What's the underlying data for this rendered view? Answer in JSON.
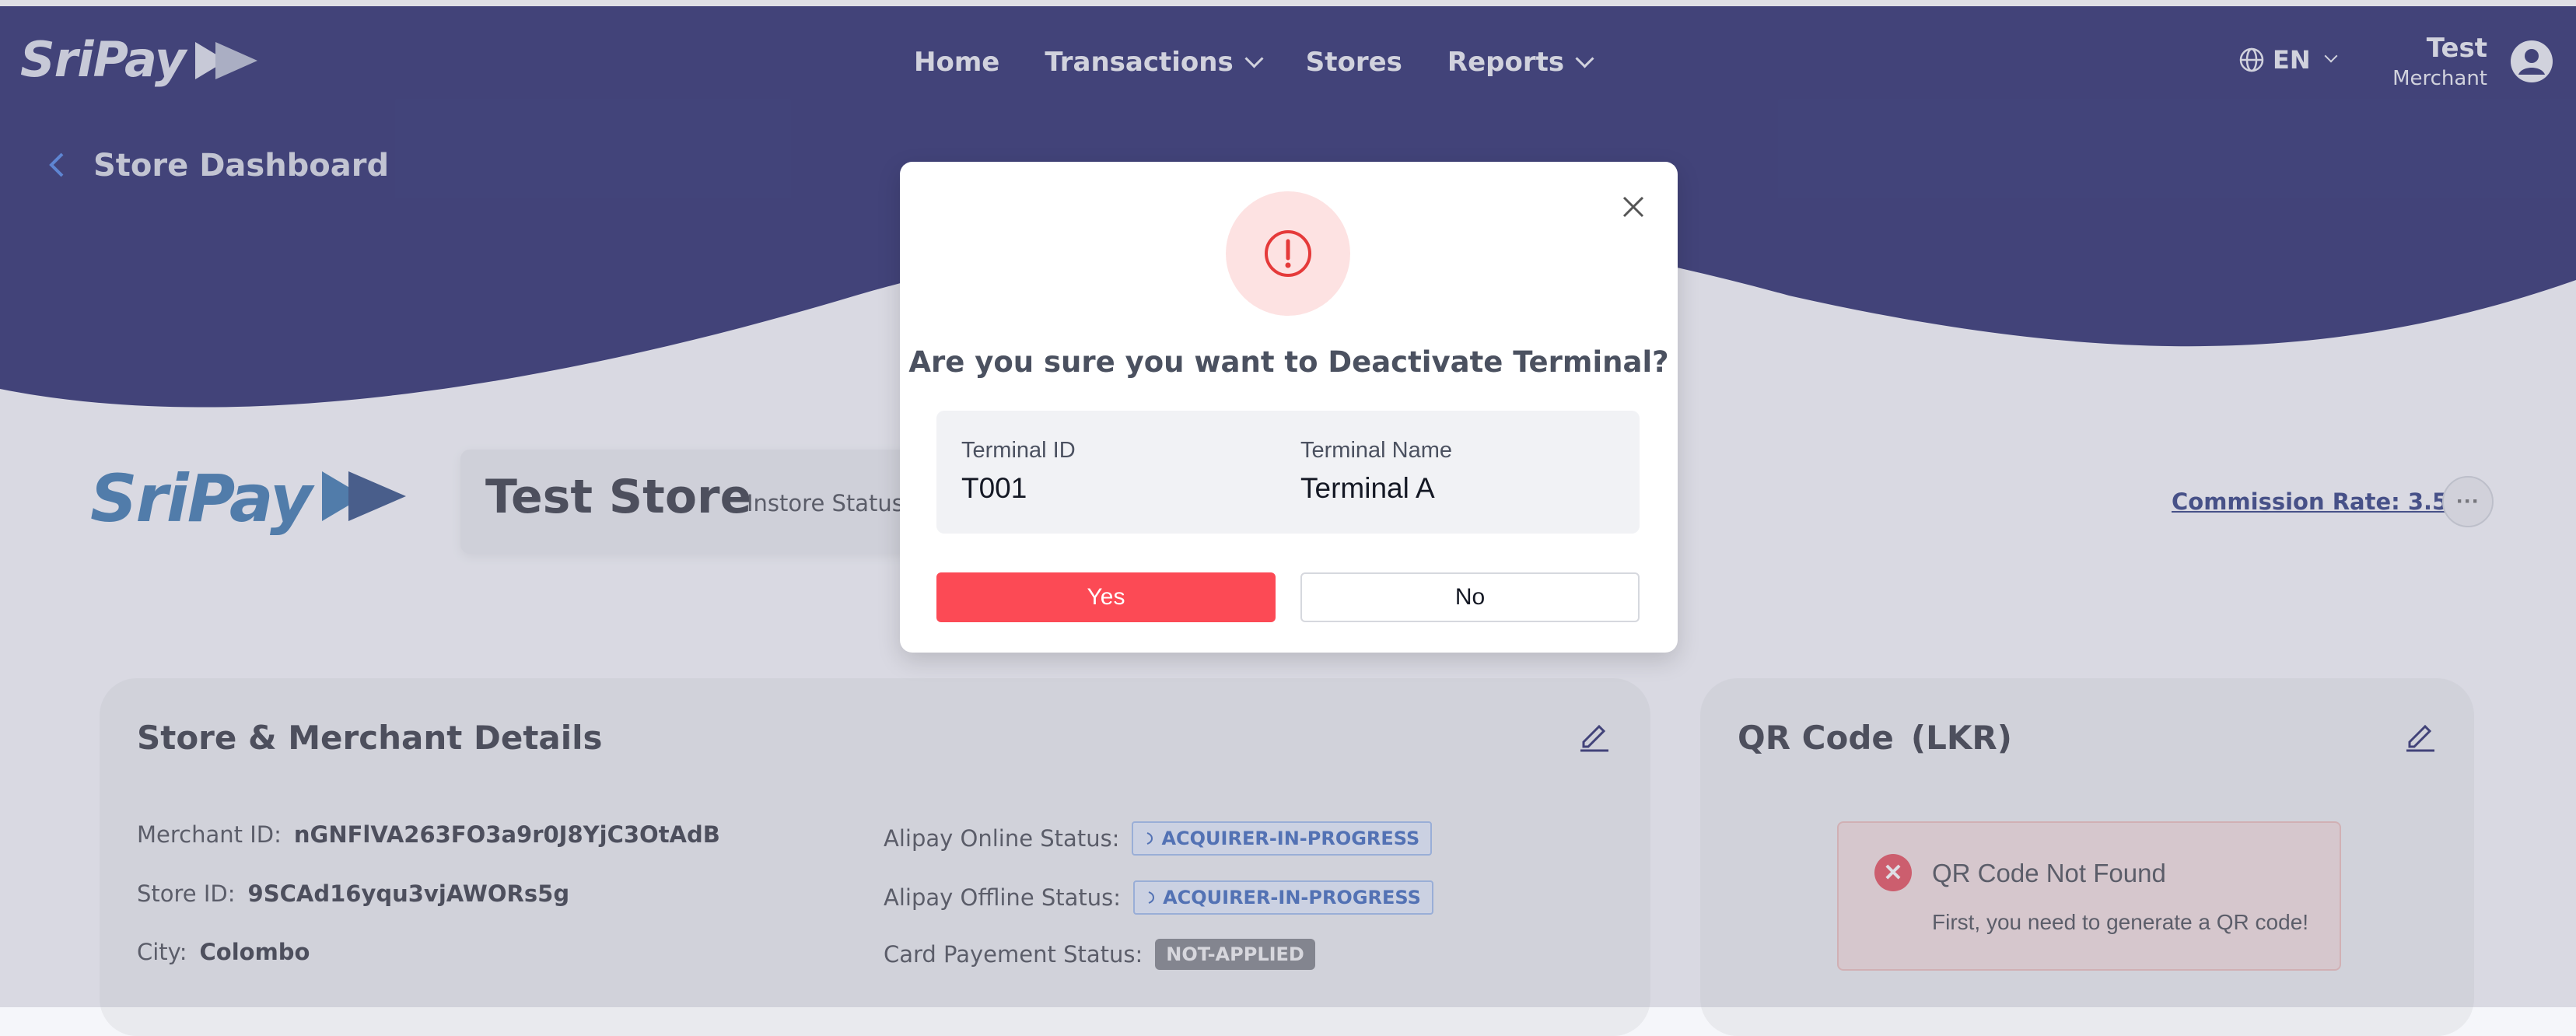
{
  "brand": {
    "name": "SriPay",
    "primary_color": "#020452",
    "accent_color": "#fc4a55"
  },
  "nav": {
    "items": [
      {
        "label": "Home",
        "has_dropdown": false
      },
      {
        "label": "Transactions",
        "has_dropdown": true
      },
      {
        "label": "Stores",
        "has_dropdown": false
      },
      {
        "label": "Reports",
        "has_dropdown": true
      }
    ],
    "language": "EN",
    "user_name": "Test",
    "user_role": "Merchant"
  },
  "page": {
    "title": "Store Dashboard"
  },
  "store": {
    "name": "Test Store",
    "instore_status_label": "Instore Status:",
    "commission_rate": "Commission Rate: 3.5 %"
  },
  "details": {
    "title": "Store & Merchant Details",
    "left": [
      {
        "label": "Merchant ID:",
        "value": "nGNFlVA263FO3a9r0J8YjC3OtAdB"
      },
      {
        "label": "Store ID:",
        "value": "9SCAd16yqu3vjAWORs5g"
      },
      {
        "label": "City:",
        "value": "Colombo"
      }
    ],
    "right": [
      {
        "label": "Alipay Online Status:",
        "value": "ACQUIRER-IN-PROGRESS"
      },
      {
        "label": "Alipay Offline Status:",
        "value": "ACQUIRER-IN-PROGRESS"
      },
      {
        "label": "Card Payement Status:",
        "value": "NOT-APPLIED"
      }
    ]
  },
  "qr": {
    "title": "QR Code",
    "currency": "(LKR)",
    "alert_title": "QR Code Not Found",
    "alert_desc": "First, you need to generate a QR code!"
  },
  "modal": {
    "question": "Are you sure you want to Deactivate Terminal?",
    "terminal_id_label": "Terminal ID",
    "terminal_id": "T001",
    "terminal_name_label": "Terminal Name",
    "terminal_name": "Terminal A",
    "yes_label": "Yes",
    "no_label": "No"
  },
  "icons": [
    "arrow-logo-icon",
    "chevron-down-icon",
    "globe-icon",
    "user-avatar-icon",
    "back-chevron-icon",
    "more-icon",
    "edit-icon",
    "spinner-icon",
    "error-x-icon",
    "close-icon",
    "exclamation-icon"
  ]
}
